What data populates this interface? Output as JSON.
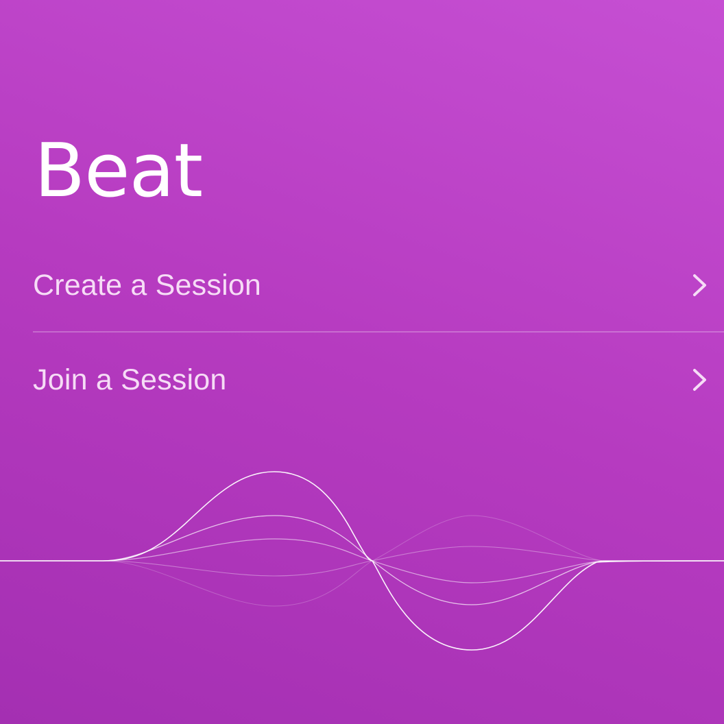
{
  "app": {
    "title": "Beat"
  },
  "menu": {
    "items": [
      {
        "label": "Create a Session",
        "icon": "chevron-right-icon"
      },
      {
        "label": "Join a Session",
        "icon": "chevron-right-icon"
      }
    ]
  },
  "colors": {
    "gradient_start": "#a42fb2",
    "gradient_end": "#c64fd3",
    "text": "#ffffff",
    "menu_text": "#f6dcf6"
  }
}
